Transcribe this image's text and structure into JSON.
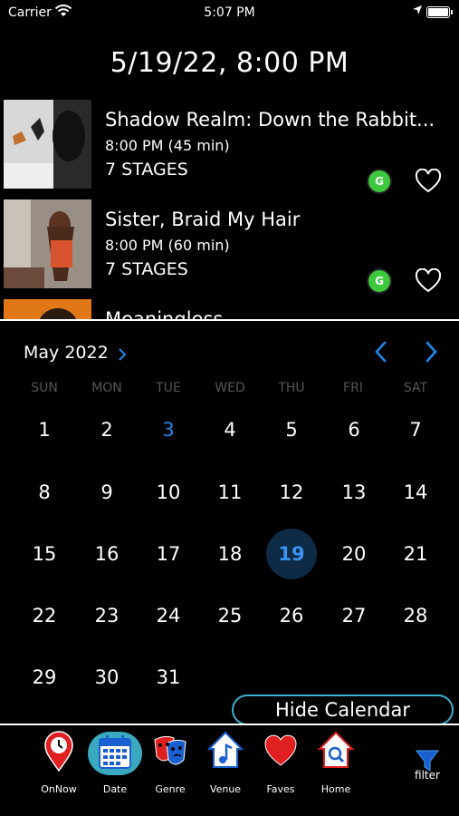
{
  "status_bar": {
    "carrier": "Carrier",
    "time": "5:07 PM"
  },
  "header": {
    "datetime": "5/19/22, 8:00 PM"
  },
  "events": [
    {
      "title": "Shadow Realm: Down the Rabbit...",
      "time": "8:00 PM  (45 min)",
      "venue": "7 STAGES",
      "rating": "G"
    },
    {
      "title": "Sister, Braid My Hair",
      "time": "8:00 PM  (60 min)",
      "venue": "7 STAGES",
      "rating": "G"
    },
    {
      "title": "Meaningless"
    }
  ],
  "calendar": {
    "month_label": "May 2022",
    "weekdays": [
      "SUN",
      "MON",
      "TUE",
      "WED",
      "THU",
      "FRI",
      "SAT"
    ],
    "days": [
      "1",
      "2",
      "3",
      "4",
      "5",
      "6",
      "7",
      "8",
      "9",
      "10",
      "11",
      "12",
      "13",
      "14",
      "15",
      "16",
      "17",
      "18",
      "19",
      "20",
      "21",
      "22",
      "23",
      "24",
      "25",
      "26",
      "27",
      "28",
      "29",
      "30",
      "31"
    ],
    "today": "3",
    "selected": "19",
    "colors": {
      "accent": "#1e88f0",
      "selected_bg": "#0e2a44",
      "weekday": "#555555"
    }
  },
  "hide_calendar_label": "Hide Calendar",
  "tabs": [
    {
      "label": "OnNow",
      "icon": "location-clock-icon"
    },
    {
      "label": "Date",
      "icon": "calendar-icon",
      "active": true
    },
    {
      "label": "Genre",
      "icon": "theater-masks-icon"
    },
    {
      "label": "Venue",
      "icon": "venue-house-music-icon"
    },
    {
      "label": "Faves",
      "icon": "heart-icon"
    },
    {
      "label": "Home",
      "icon": "home-search-icon"
    },
    {
      "label": "filter",
      "icon": "filter-funnel-icon"
    }
  ]
}
